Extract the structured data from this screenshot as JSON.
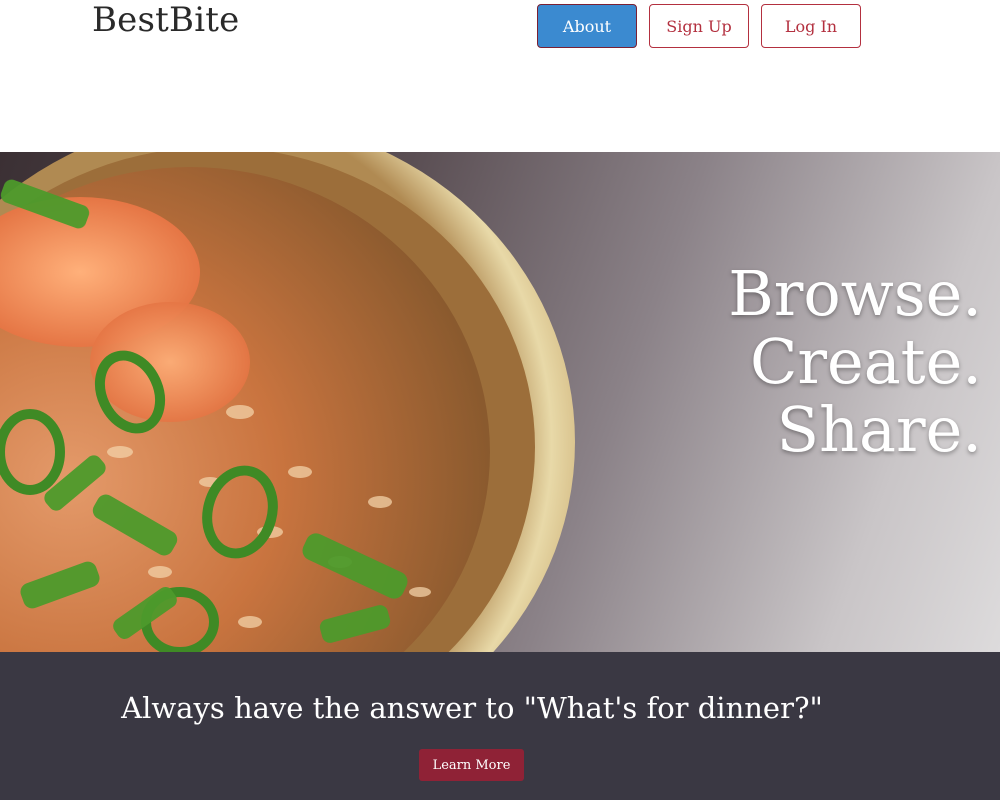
{
  "header": {
    "brand": "BestBite",
    "nav": {
      "about": "About",
      "signup": "Sign Up",
      "login": "Log In"
    }
  },
  "hero": {
    "lines": [
      "Browse.",
      "Create.",
      "Share."
    ],
    "image": "bowl-of-risotto-with-green-onions"
  },
  "band": {
    "tagline": "Always have the answer to \"What's for dinner?\"",
    "cta": "Learn More"
  },
  "colors": {
    "primary_blue": "#3b8ad0",
    "accent_red": "#b3303f",
    "cta_red": "#8f2236",
    "band_bg": "#3a3843"
  }
}
